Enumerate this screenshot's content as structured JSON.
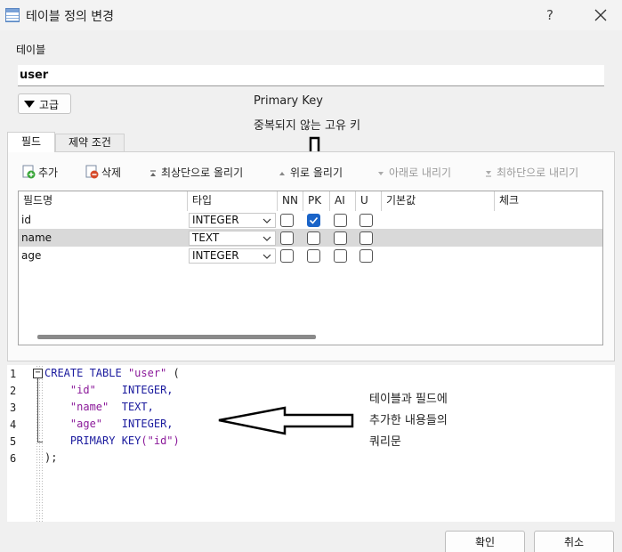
{
  "window": {
    "title": "테이블 정의 변경",
    "help_label": "?"
  },
  "table_group": {
    "label": "테이블",
    "name_value": "user",
    "advanced_label": "고급"
  },
  "annotation_pk": {
    "line1": "Primary Key",
    "line2": "중복되지 않는 고유 키"
  },
  "tabs": [
    {
      "label": "필드",
      "active": true
    },
    {
      "label": "제약 조건",
      "active": false
    }
  ],
  "toolbar": {
    "add": "추가",
    "delete": "삭제",
    "move_top": "최상단으로 올리기",
    "move_up": "위로 올리기",
    "move_down": "아래로 내리기",
    "move_bottom": "최하단으로 내리기"
  },
  "grid": {
    "headers": [
      "필드명",
      "타입",
      "NN",
      "PK",
      "AI",
      "U",
      "기본값",
      "체크"
    ],
    "rows": [
      {
        "name": "id",
        "type": "INTEGER",
        "nn": false,
        "pk": true,
        "ai": false,
        "u": false
      },
      {
        "name": "name",
        "type": "TEXT",
        "nn": false,
        "pk": false,
        "ai": false,
        "u": false
      },
      {
        "name": "age",
        "type": "INTEGER",
        "nn": false,
        "pk": false,
        "ai": false,
        "u": false
      }
    ],
    "selected_row": 1,
    "scroll_position": 0.48
  },
  "sql": {
    "line_numbers": [
      "1",
      "2",
      "3",
      "4",
      "5",
      "6"
    ],
    "keywords": {
      "create_table": "CREATE TABLE",
      "integer": "INTEGER,",
      "text": "TEXT,",
      "primary_key": "PRIMARY KEY"
    },
    "table": "\"user\"",
    "fields": [
      "\"id\"",
      "\"name\"",
      "\"age\""
    ],
    "pk_field": "(\"id\")",
    "open_paren": "(",
    "close": ");",
    "fold_label": "−"
  },
  "annotation_sql": {
    "line1": "테이블과 필드에",
    "line2": "추가한 내용들의",
    "line3": "쿼리문"
  },
  "footer": {
    "ok": "확인",
    "cancel": "취소"
  },
  "colors": {
    "checkbox_on": "#1a64c8",
    "keyword": "#1b1b9e",
    "string": "#8b1a9a",
    "row_selected": "#d9d9d9"
  }
}
